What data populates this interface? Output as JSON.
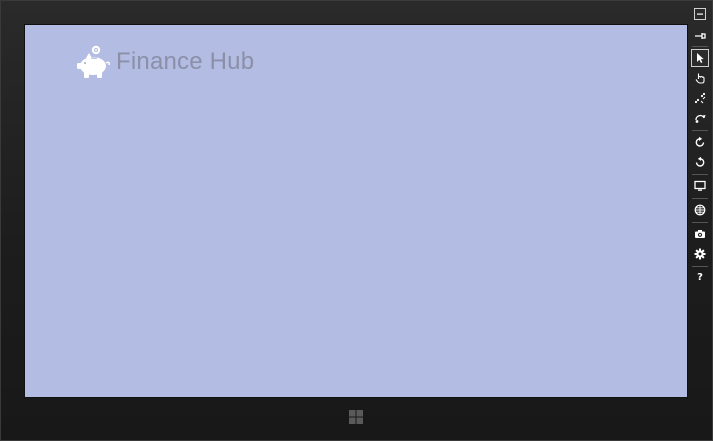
{
  "colors": {
    "screen_bg": "#b3bce2",
    "title_color": "#8b8fa8",
    "logo_color": "#ffffff"
  },
  "app": {
    "title": "Finance Hub",
    "logo_icon": "piggy-bank-icon"
  },
  "simulator_toolbar": {
    "items": [
      {
        "name": "minimize",
        "icon": "minimize-icon"
      },
      {
        "name": "pin-on-top",
        "icon": "pin-icon"
      },
      {
        "name": "mouse-mode",
        "icon": "mouse-pointer-icon",
        "active": true
      },
      {
        "name": "touch-mode",
        "icon": "touch-hand-icon"
      },
      {
        "name": "pinch-zoom",
        "icon": "pinch-zoom-icon"
      },
      {
        "name": "rotation-touch",
        "icon": "rotation-touch-icon"
      },
      {
        "name": "rotate-clockwise",
        "icon": "rotate-clockwise-icon"
      },
      {
        "name": "rotate-counterclockwise",
        "icon": "rotate-counterclockwise-icon"
      },
      {
        "name": "change-resolution",
        "icon": "monitor-icon"
      },
      {
        "name": "set-location",
        "icon": "globe-icon"
      },
      {
        "name": "screenshot",
        "icon": "camera-icon"
      },
      {
        "name": "screenshot-settings",
        "icon": "gear-icon"
      },
      {
        "name": "help",
        "icon": "help-icon",
        "label": "?"
      }
    ]
  },
  "windows_button": {
    "icon": "windows-logo-icon"
  }
}
